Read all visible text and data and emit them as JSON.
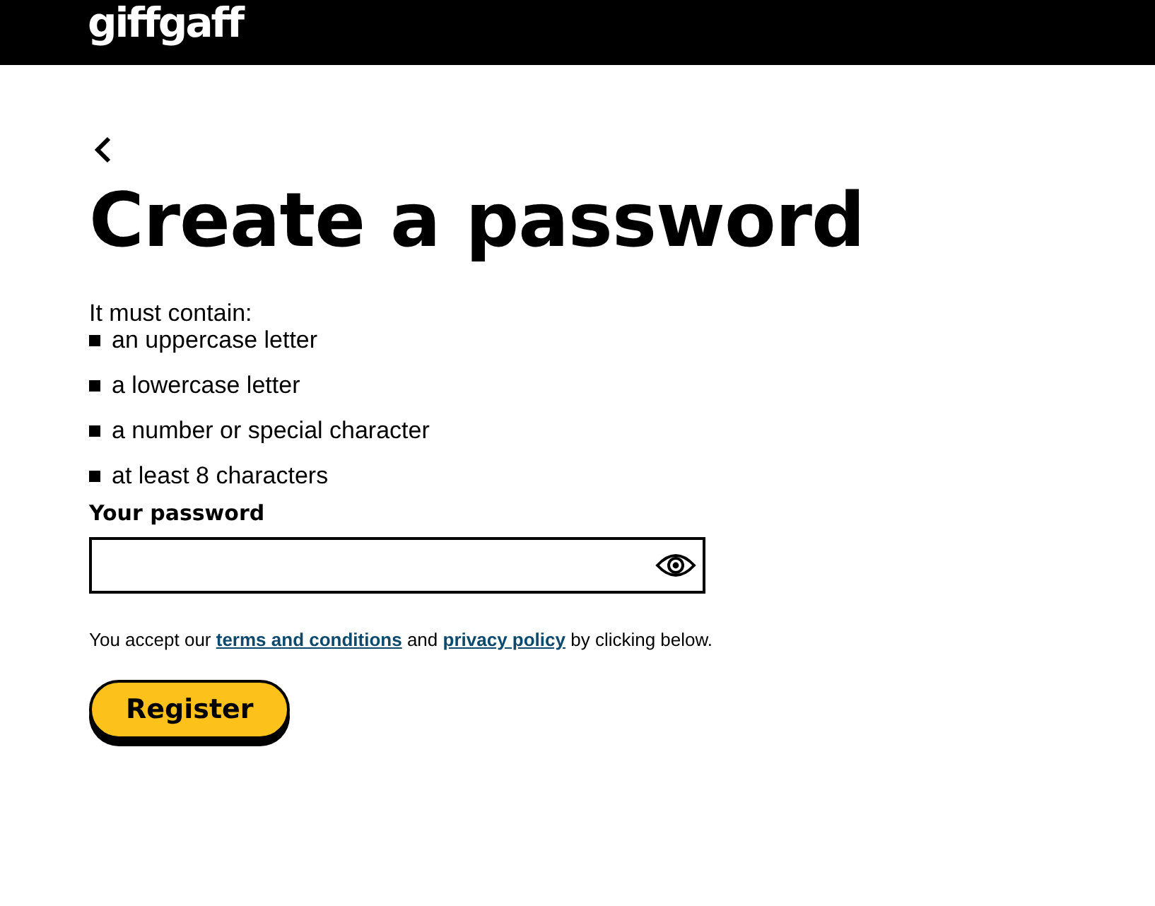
{
  "header": {
    "logo": "giffgaff"
  },
  "title": "Create a password",
  "requirements": {
    "intro": "It must contain:",
    "items": [
      "an uppercase letter",
      "a lowercase letter",
      "a number or special character",
      "at least 8 characters"
    ]
  },
  "password": {
    "label": "Your password"
  },
  "consent": [
    {
      "kind": "text",
      "text": "You accept our "
    },
    {
      "kind": "link",
      "text": "terms and conditions"
    },
    {
      "kind": "text",
      "text": " and "
    },
    {
      "kind": "link",
      "text": "privacy policy"
    },
    {
      "kind": "text",
      "text": " by clicking below."
    }
  ],
  "buttons": [
    "Register"
  ]
}
